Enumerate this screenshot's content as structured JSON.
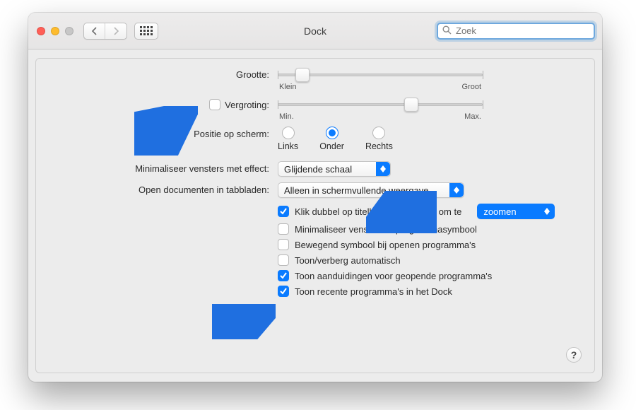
{
  "window": {
    "title": "Dock"
  },
  "toolbar": {
    "search_placeholder": "Zoek"
  },
  "form": {
    "size": {
      "label": "Grootte:",
      "min": "Klein",
      "max": "Groot",
      "value_pct": 12
    },
    "magnification": {
      "checked": false,
      "label": "Vergroting:",
      "min": "Min.",
      "max": "Max.",
      "value_pct": 65
    },
    "position": {
      "label": "Positie op scherm:",
      "options": [
        {
          "label": "Links",
          "selected": false
        },
        {
          "label": "Onder",
          "selected": true
        },
        {
          "label": "Rechts",
          "selected": false
        }
      ]
    },
    "minimize_effect": {
      "label": "Minimaliseer vensters met effect:",
      "value": "Glijdende schaal"
    },
    "open_docs_tabs": {
      "label": "Open documenten in tabbladen:",
      "value": "Alleen in schermvullende weergave"
    },
    "dblclick": {
      "checked": true,
      "label": "Klik dubbel op titelbalk van venster om te",
      "option": "zoomen"
    },
    "minimize_into_app": {
      "checked": false,
      "label": "Minimaliseer vensters in programmasymbool"
    },
    "animate_open": {
      "checked": false,
      "label": "Bewegend symbool bij openen programma's"
    },
    "autohide": {
      "checked": false,
      "label": "Toon/verberg automatisch"
    },
    "show_indicators": {
      "checked": true,
      "label": "Toon aanduidingen voor geopende programma's"
    },
    "show_recents": {
      "checked": true,
      "label": "Toon recente programma's in het Dock"
    }
  },
  "help_glyph": "?"
}
